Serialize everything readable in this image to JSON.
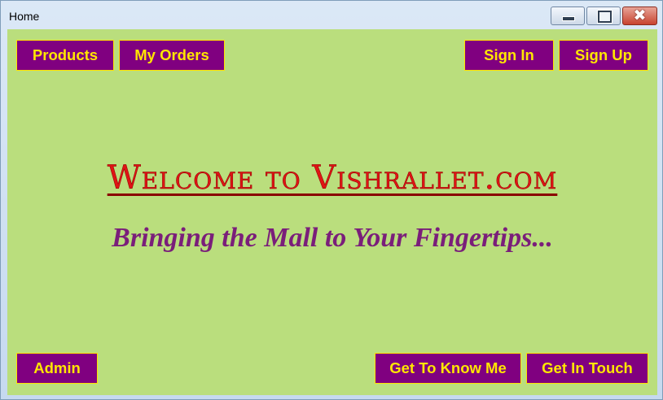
{
  "window": {
    "title": "Home",
    "controls": {
      "minimize_icon": "minimize-icon",
      "maximize_icon": "maximize-icon",
      "close_glyph": "✖"
    }
  },
  "nav": {
    "products_label": "Products",
    "orders_label": "My Orders",
    "signin_label": "Sign In",
    "signup_label": "Sign Up"
  },
  "hero": {
    "welcome": "Welcome to Vishrallet.com",
    "tagline": "Bringing the Mall to Your Fingertips..."
  },
  "footer": {
    "admin_label": "Admin",
    "know_label": "Get To Know Me",
    "touch_label": "Get In Touch"
  },
  "colors": {
    "background": "#bade7d",
    "button_bg": "#800080",
    "button_text": "#ffe600",
    "welcome_text": "#e01414",
    "tagline_text": "#7a1e7a"
  }
}
